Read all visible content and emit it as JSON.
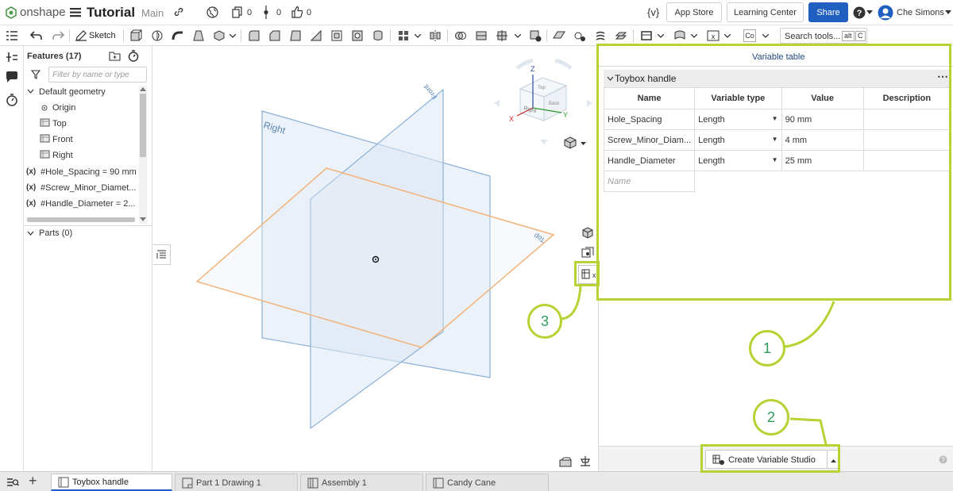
{
  "header": {
    "logo": "onshape",
    "doc_title": "Tutorial",
    "branch": "Main",
    "count_a": "0",
    "count_b": "0",
    "count_c": "0",
    "custom_label": "{v}",
    "app_store": "App Store",
    "learning_center": "Learning Center",
    "share": "Share",
    "user": "Che Simons"
  },
  "toolbar": {
    "sketch": "Sketch",
    "search": "Search tools...",
    "shortcut_alt": "alt",
    "shortcut_c": "C",
    "co_label": "Co"
  },
  "feature_panel": {
    "title": "Features (17)",
    "filter_placeholder": "Filter by name or type",
    "default_geometry": "Default geometry",
    "origin": "Origin",
    "top": "Top",
    "front": "Front",
    "right": "Right",
    "var_prefix": "(x)",
    "var1": "#Hole_Spacing = 90 mm",
    "var2": "#Screw_Minor_Diamet...",
    "var3": "#Handle_Diameter = 2...",
    "parts": "Parts (0)"
  },
  "viewport": {
    "plane_right": "Right",
    "plane_front": "Front",
    "plane_top": "Top",
    "cube_z": "Z",
    "cube_x": "X",
    "cube_y": "Y",
    "cube_top": "Top",
    "cube_right": "Right",
    "cube_back": "Back"
  },
  "variable_panel": {
    "tab_title": "Variable table",
    "studio_name": "Toybox handle",
    "columns": [
      "Name",
      "Variable type",
      "Value",
      "Description"
    ],
    "rows": [
      {
        "name": "Hole_Spacing",
        "type": "Length",
        "value": "90 mm",
        "description": ""
      },
      {
        "name": "Screw_Minor_Diam...",
        "type": "Length",
        "value": "4 mm",
        "description": ""
      },
      {
        "name": "Handle_Diameter",
        "type": "Length",
        "value": "25 mm",
        "description": ""
      }
    ],
    "name_placeholder": "Name",
    "create_button": "Create Variable Studio"
  },
  "callouts": {
    "one": "1",
    "two": "2",
    "three": "3"
  },
  "tabs": [
    {
      "label": "Toybox handle",
      "active": true
    },
    {
      "label": "Part 1 Drawing 1",
      "active": false
    },
    {
      "label": "Assembly 1",
      "active": false
    },
    {
      "label": "Candy Cane",
      "active": false
    }
  ],
  "colors": {
    "accent_blue": "#1f5fbf",
    "callout_green": "#b5d334",
    "callout_text": "#2d9a5a",
    "plane_blue": "#8ab0d6",
    "plane_orange": "#f2b37a"
  }
}
